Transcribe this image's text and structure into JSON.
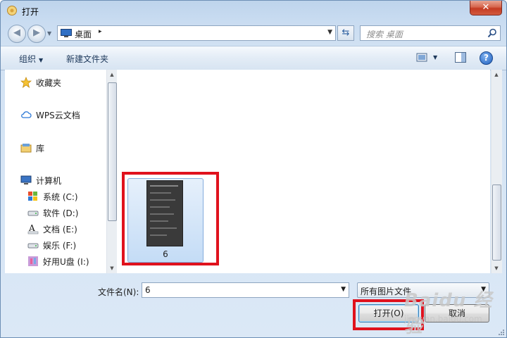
{
  "window": {
    "title": "打开",
    "close_glyph": "✕"
  },
  "address": {
    "location": "桌面",
    "separator": "▸"
  },
  "search": {
    "placeholder": "搜索 桌面"
  },
  "toolbar": {
    "organize": "组织",
    "new_folder": "新建文件夹",
    "help": "?"
  },
  "nav": {
    "items": [
      {
        "label": "收藏夹",
        "icon": "star-icon"
      },
      {
        "label": "WPS云文档",
        "icon": "cloud-icon"
      },
      {
        "label": "库",
        "icon": "library-icon"
      },
      {
        "label": "计算机",
        "icon": "computer-icon"
      },
      {
        "label": "系统 (C:)",
        "icon": "system-drive-icon"
      },
      {
        "label": "软件 (D:)",
        "icon": "drive-icon"
      },
      {
        "label": "文档 (E:)",
        "icon": "text-drive-icon"
      },
      {
        "label": "娱乐 (F:)",
        "icon": "drive-icon"
      },
      {
        "label": "好用U盘 (I:)",
        "icon": "usb-drive-icon"
      }
    ]
  },
  "files": [
    {
      "name": "6",
      "selected": true
    }
  ],
  "bottom": {
    "filename_label": "文件名(N):",
    "filename_value": "6",
    "filetype_value": "所有图片文件",
    "open_button": "打开(O)",
    "cancel_button": "取消"
  },
  "watermark": {
    "main": "Baidu 经验",
    "sub": "jingyan.baidu.com"
  },
  "colors": {
    "highlight": "#e0121d",
    "selection": "#c4dcf6"
  }
}
